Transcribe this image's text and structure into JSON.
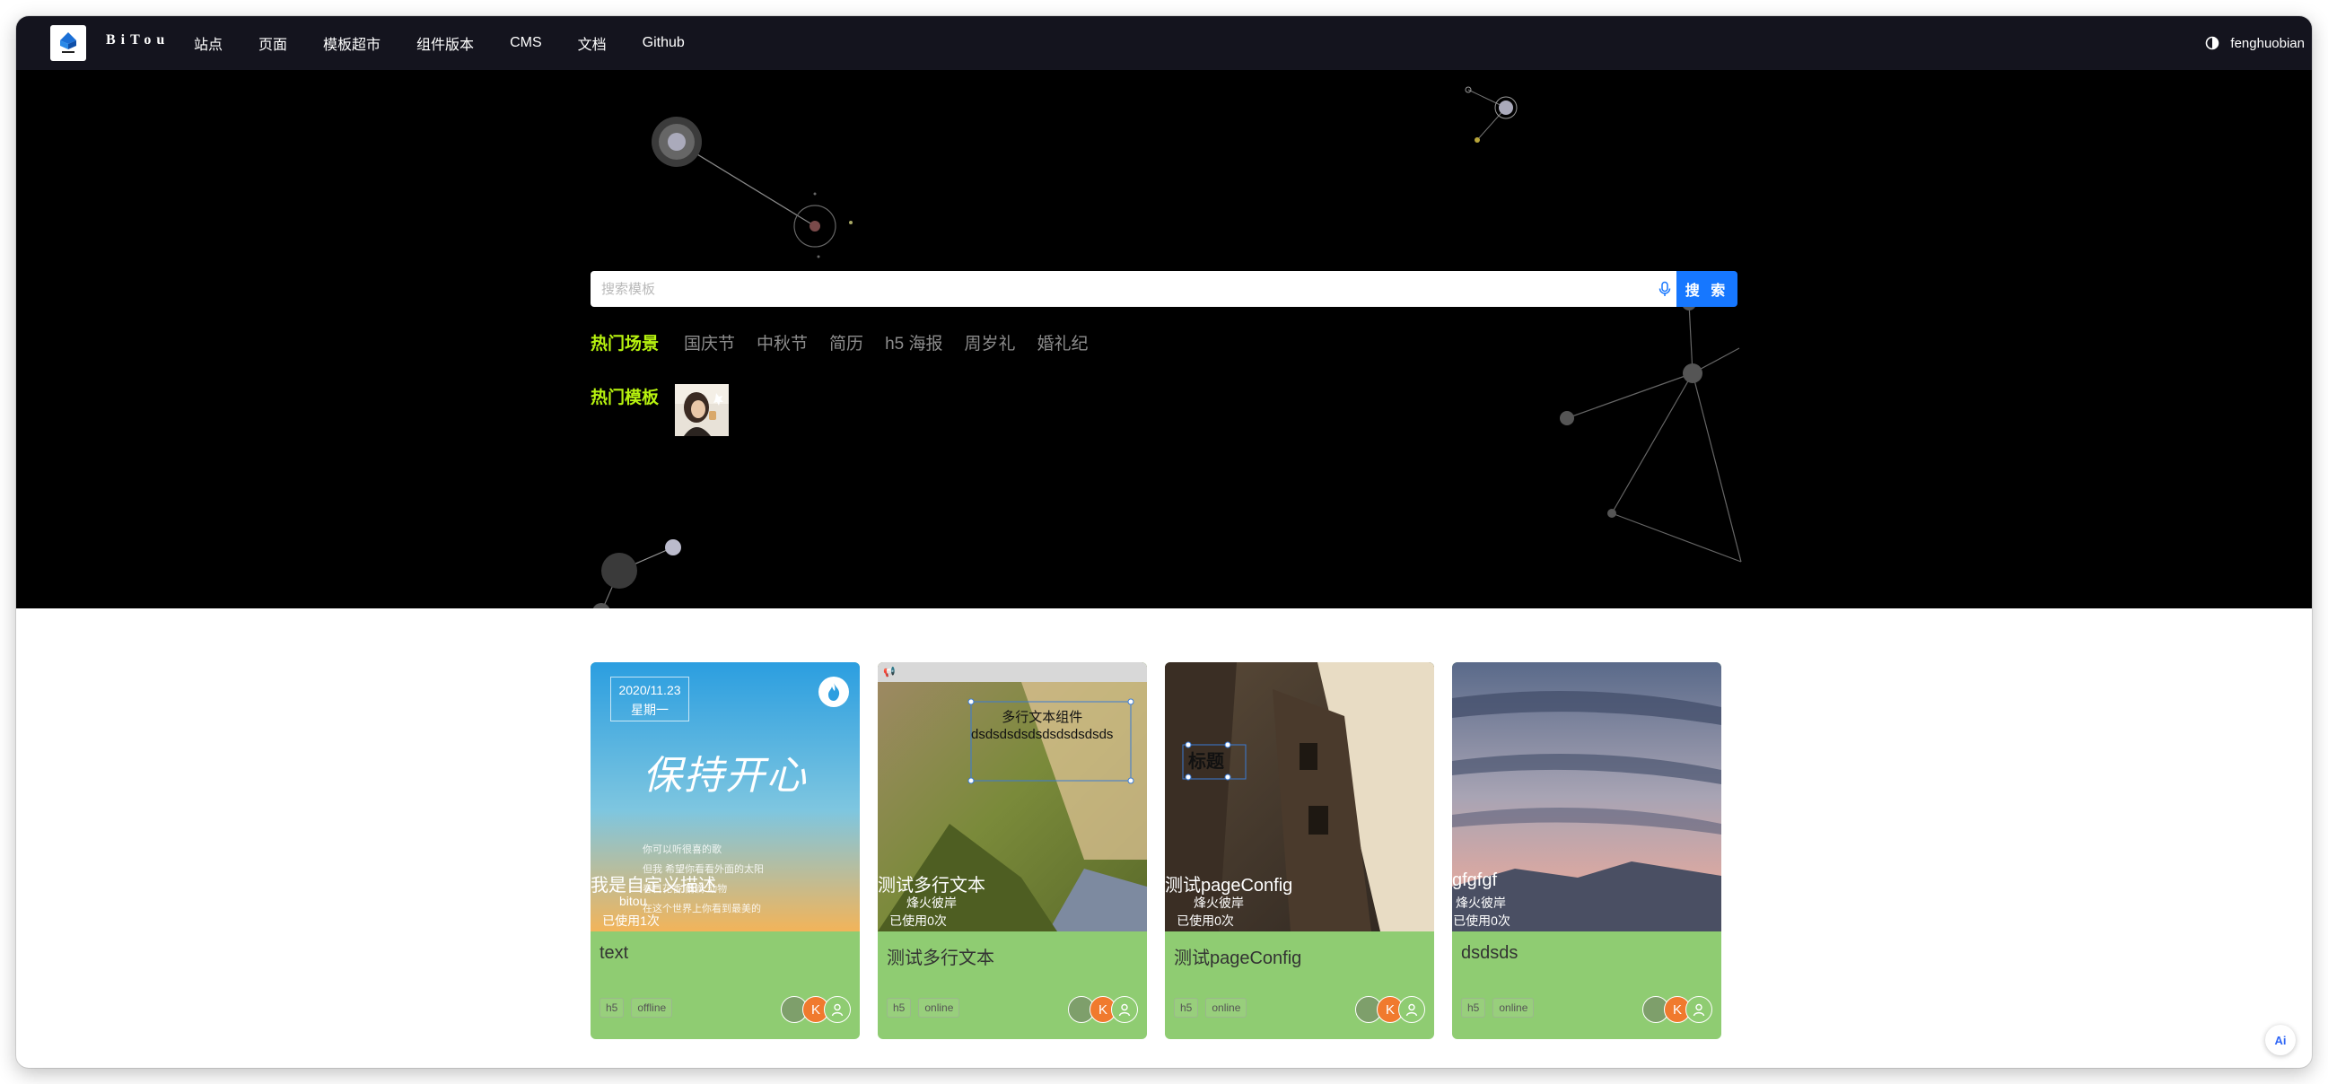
{
  "nav": {
    "brand": "BiTou",
    "links": [
      "站点",
      "页面",
      "模板超市",
      "组件版本",
      "CMS",
      "文档",
      "Github"
    ],
    "username": "fenghuobian"
  },
  "search": {
    "placeholder": "搜索模板",
    "button_label": "搜 索"
  },
  "hot_scenes": {
    "label": "热门场景",
    "tags": [
      "国庆节",
      "中秋节",
      "简历",
      "h5 海报",
      "周岁礼",
      "婚礼纪"
    ]
  },
  "hot_templates": {
    "label": "热门模板"
  },
  "cards": [
    {
      "title": "text",
      "tags": [
        "h5",
        "offline"
      ],
      "overlay_desc": "我是自定义描述",
      "overlay_author": "bitou",
      "overlay_used": "已使用1次",
      "cover": {
        "date": "2020/11.23",
        "weekday": "星期一",
        "big_title": "保持开心",
        "lines": [
          "你可以听很喜的歌",
          "但我 希望你看看外面的太阳",
          "春日花香 雨滴 动物",
          "在这个世界上你看到最美的"
        ]
      },
      "avatar_letter": "K"
    },
    {
      "title": "测试多行文本",
      "tags": [
        "h5",
        "online"
      ],
      "overlay_desc": "测试多行文本",
      "overlay_author": "烽火彼岸",
      "overlay_used": "已使用0次",
      "cover": {
        "multi_text": [
          "多行文本组件",
          "dsdsdsdsdsdsdsdsdsds"
        ]
      },
      "avatar_letter": "K"
    },
    {
      "title": "测试pageConfig",
      "tags": [
        "h5",
        "online"
      ],
      "overlay_desc": "测试pageConfig",
      "overlay_author": "烽火彼岸",
      "overlay_used": "已使用0次",
      "cover": {
        "title_comp": "标题"
      },
      "avatar_letter": "K"
    },
    {
      "title": "dsdsds",
      "tags": [
        "h5",
        "online"
      ],
      "overlay_desc": "gfgfgf",
      "overlay_author": "烽火彼岸",
      "overlay_used": "已使用0次",
      "cover": {},
      "avatar_letter": "K"
    }
  ],
  "ai_button": "Ai",
  "colors": {
    "nav_bg": "#14141e",
    "hero_bg": "#000000",
    "accent": "#b7f20f",
    "search_button": "#1677ff",
    "card_bg": "#8fcc72"
  }
}
